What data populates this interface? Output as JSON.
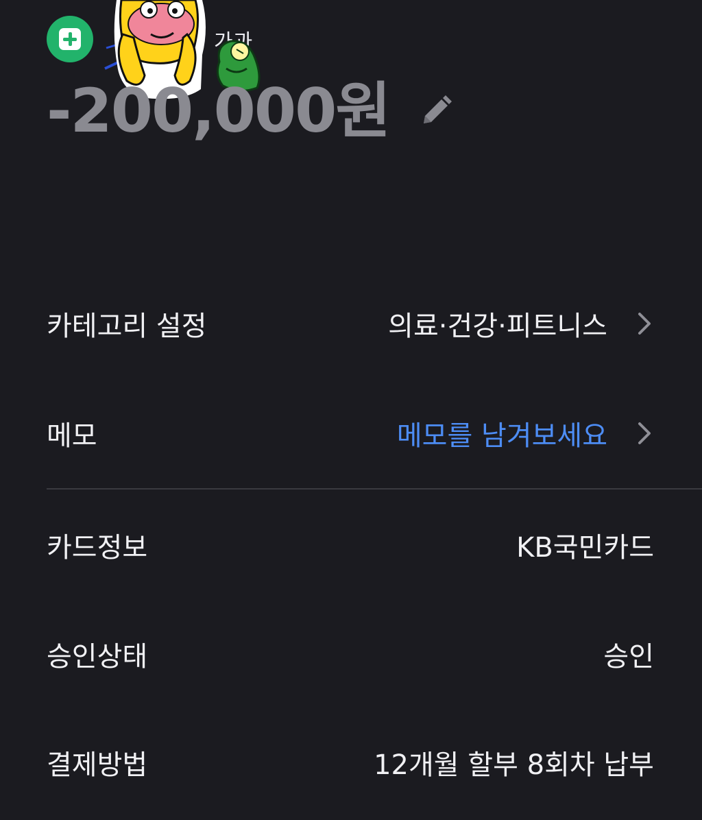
{
  "header": {
    "merchant_partial": "가과",
    "amount": "-200,000원"
  },
  "icons": {
    "category_badge": "plus-square-icon",
    "edit": "pencil-icon",
    "chevron": "chevron-right-icon"
  },
  "rows": {
    "category": {
      "label": "카테고리 설정",
      "value": "의료·건강·피트니스"
    },
    "memo": {
      "label": "메모",
      "value": "메모를 남겨보세요"
    },
    "card": {
      "label": "카드정보",
      "value": "KB국민카드"
    },
    "approval": {
      "label": "승인상태",
      "value": "승인"
    },
    "payment": {
      "label": "결제방법",
      "value": "12개월 할부 8회차 납부"
    }
  },
  "colors": {
    "background": "#1b1b20",
    "badge_green": "#22b36b",
    "amount_gray": "#8a8a91",
    "link_blue": "#4d8df5"
  }
}
